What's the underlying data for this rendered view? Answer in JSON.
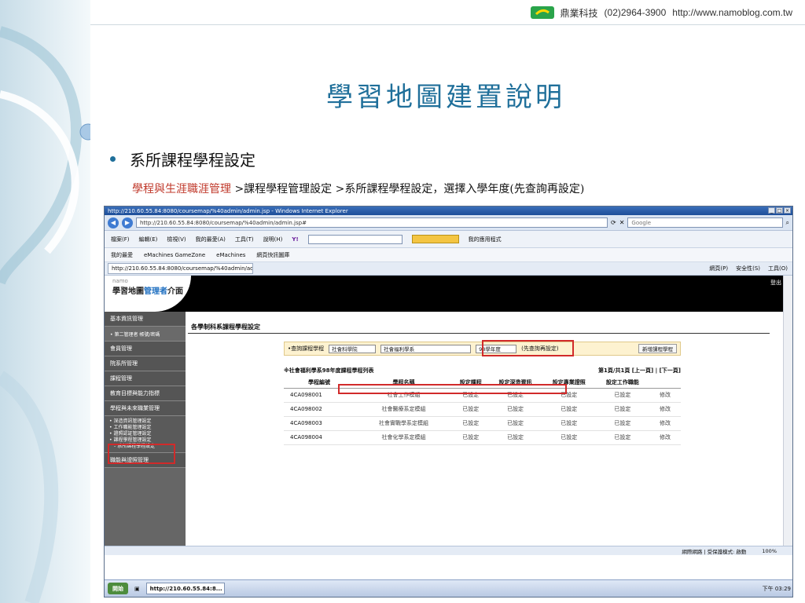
{
  "header": {
    "company": "鼎業科技",
    "phone": "(02)2964-3900",
    "website": "http://www.namoblog.com.tw"
  },
  "slide": {
    "title": "學習地圖建置說明",
    "bullet": "系所課程學程設定",
    "path_red": "學程與生涯職涯管理",
    "path_rest": " >課程學程管理設定 >系所課程學程設定，選擇入學年度(先查詢再設定)"
  },
  "browser": {
    "title": "http://210.60.55.84:8080/coursemap/%40admin/admin.jsp - Windows Internet Explorer",
    "url": "http://210.60.55.84:8080/coursemap/%40admin/admin.jsp#",
    "search_placeholder": "Google",
    "menu": [
      "檔案(F)",
      "編輯(E)",
      "檢視(V)",
      "我的最愛(A)",
      "工具(T)",
      "說明(H)"
    ],
    "menu_extra": "我的應用程式",
    "favorites": [
      "我的最愛",
      "eMachines GameZone",
      "eMachines",
      "網頁快訊圖庫"
    ],
    "tab_label": "http://210.60.55.84:8080/coursemap/%40admin/admin....",
    "tab_tools": [
      "網頁(P)",
      "安全性(S)",
      "工具(O)"
    ],
    "status_zone": "網際網路 | 受保護模式: 啟動",
    "zoom": "100%"
  },
  "app": {
    "logo_small": "namo",
    "logo_main": "學習地圖",
    "logo_accent": "管理者",
    "logo_tail": "介面",
    "logout": "登出",
    "side_menu": {
      "basic": "基本資訊管理",
      "basic_sub": "• 第二管理者 帳號/密碼",
      "member": "會員管理",
      "dept": "院系所管理",
      "course": "課程管理",
      "edu": "教育目標與能力指標",
      "program": "學程與未來職業管理",
      "sub1": "• 深造資訊管理設定",
      "sub2": "• 工作職能管理設定",
      "sub3": "• 證照認証管理設定",
      "sub4": "• 課程學程管理設定",
      "sub5": "- 系所課程學程設定",
      "skill": "職能與證照管理"
    },
    "breadcrumb": "各學制科系課程學程設定",
    "query": {
      "label": "•查詢課程學程",
      "college": "社會科學院",
      "dept": "社會福利學系",
      "year": "98學年度",
      "query_btn": "(先查詢再設定)",
      "new_btn": "新增課程學程"
    },
    "list_title": "※社會福利學系98年度課程學程列表",
    "pager": "第1頁/共1頁 [上一頁] | [下一頁]",
    "table": {
      "headers": [
        "學程編號",
        "學程名稱",
        "設定課程",
        "設定深造資訊",
        "設定專業證照",
        "設定工作職能",
        ""
      ],
      "rows": [
        [
          "4CA098001",
          "社會工作模組",
          "已設定",
          "已設定",
          "已設定",
          "已設定",
          "修改"
        ],
        [
          "4CA098002",
          "社會醫療系定模組",
          "已設定",
          "已設定",
          "已設定",
          "已設定",
          "修改"
        ],
        [
          "4CA098003",
          "社會實戰學系定模組",
          "已設定",
          "已設定",
          "已設定",
          "已設定",
          "修改"
        ],
        [
          "4CA098004",
          "社會化學系定模組",
          "已設定",
          "已設定",
          "已設定",
          "已設定",
          "修改"
        ]
      ]
    }
  },
  "taskbar": {
    "start": "開始",
    "task": "http://210.60.55.84:8...",
    "clock": "下午 03:29"
  }
}
